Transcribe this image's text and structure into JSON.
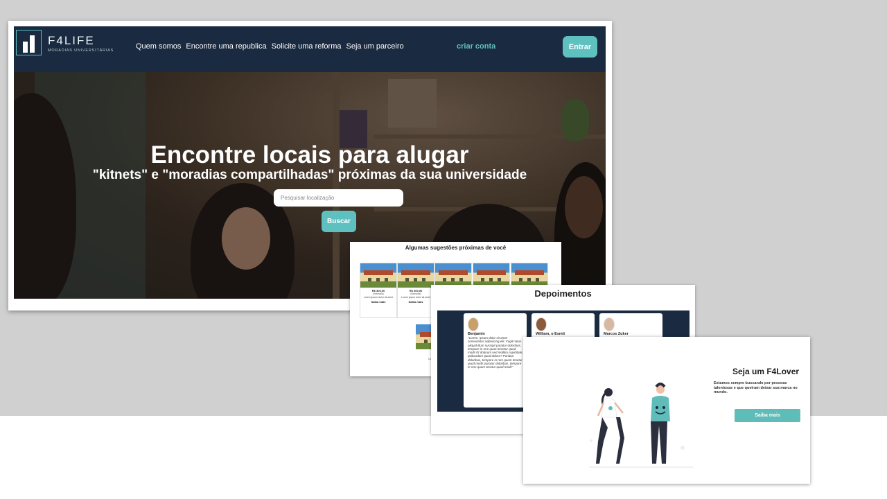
{
  "brand": {
    "name": "F4LIFE",
    "tagline": "MORADIAS UNIVERSITÁRIAS",
    "accent": "#5fc0c0",
    "navy": "#1a2a40"
  },
  "nav": {
    "links": [
      "Quem somos",
      "Encontre uma republica",
      "Solicite uma reforma",
      "Seja um parceiro"
    ],
    "signup": "criar conta",
    "login": "Entrar"
  },
  "hero": {
    "title": "Encontre locais para alugar",
    "subtitle": "\"kitnets\" e \"moradias compartilhadas\" próximas da sua universidade",
    "search_placeholder": "Pesquisar localização",
    "search_button": "Buscar"
  },
  "suggestions": {
    "title": "Algumas sugestões próximas de você",
    "items": [
      {
        "price": "R$ 300,00",
        "period": "(mensais)",
        "desc": "Lorem ipsum dolor sit amet",
        "link": "Saiba mais"
      },
      {
        "price": "R$ 300,00",
        "period": "(mensais)",
        "desc": "Lorem ipsum dolor sit amet",
        "link": "Saiba mais"
      },
      {
        "price": "",
        "period": "",
        "desc": "",
        "link": ""
      },
      {
        "price": "",
        "period": "",
        "desc": "",
        "link": ""
      },
      {
        "price": "",
        "period": "",
        "desc": "",
        "link": ""
      },
      {
        "price": "R$",
        "period": "(m",
        "desc": "Lorem ipsu",
        "link": "Sa"
      }
    ]
  },
  "testimonials": {
    "title": "Depoimentos",
    "items": [
      {
        "name": "Benjamin",
        "text": "\"Lorem, ipsum dolor sit amet consectetur adipisicing elit. Fugit natus aliquid illum suscipit pariatur doloribus, tempore in rem quam tenetur quod modi! Et dolorum sed mollitia cupiditate, quibusdam quod dolore? Pariatur doloribus, tempore in rem quam tenetur quod modi! pariatur doloribus, tempore in rem quam tenetur quod modi!\""
      },
      {
        "name": "William, o Esmit",
        "text": ""
      },
      {
        "name": "Marcos Zuker",
        "text": ""
      }
    ]
  },
  "lover": {
    "title": "Seja um F4Lover",
    "text": "Estamos sempre buscando por pessoas talentosas e que queiram deixar sua marca no mundo.",
    "button": "Saiba mais"
  }
}
